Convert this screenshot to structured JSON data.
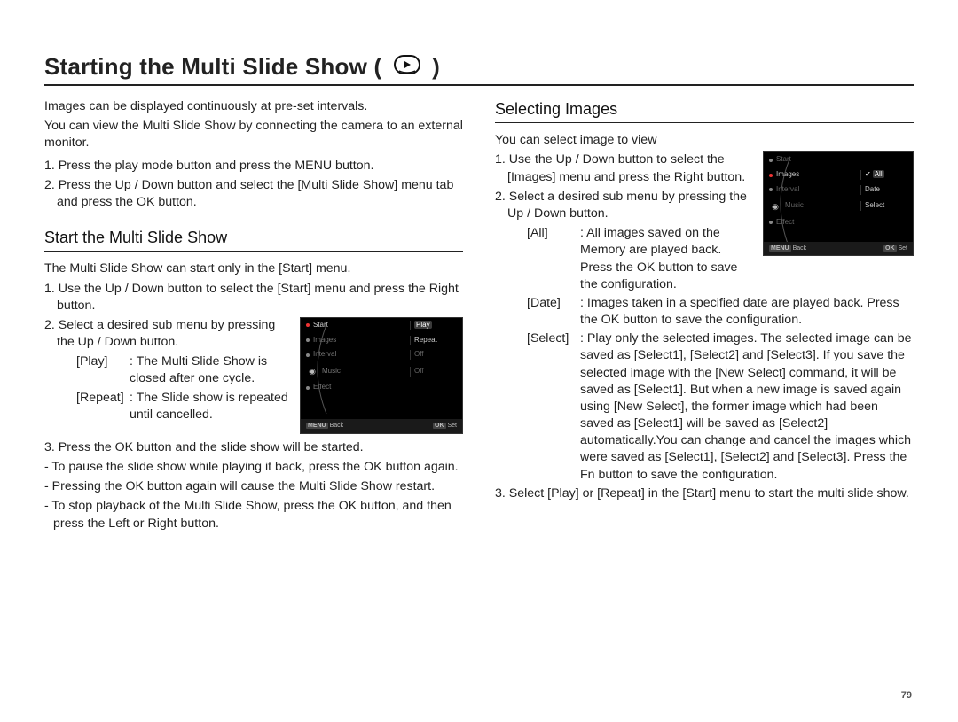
{
  "page_number": "79",
  "title_pre": "Starting the Multi Slide Show ( ",
  "title_post": " )",
  "intro": {
    "p1": "Images can be displayed continuously at pre-set intervals.",
    "p2": "You can view the Multi Slide Show by connecting the camera to an external monitor.",
    "s1": "1. Press the play mode button and press the MENU button.",
    "s2": "2. Press the Up / Down button and select the [Multi Slide Show] menu tab and press the OK button."
  },
  "left": {
    "heading": "Start the Multi Slide Show",
    "p1": "The Multi Slide Show can start only in the [Start] menu.",
    "s1": "1. Use the Up / Down button  to select the [Start] menu and press the Right button.",
    "s2": "2. Select a desired sub menu by pressing the Up / Down button.",
    "play_k": "[Play]",
    "play_v": ": The Multi Slide Show is closed after one cycle.",
    "repeat_k": "[Repeat]",
    "repeat_v": ": The Slide show is repeated until cancelled.",
    "s3": "3. Press the OK button and the slide show will be started.",
    "s3a": "- To pause the slide show while playing it back, press the OK button again.",
    "s3b": "- Pressing the OK button again will cause the Multi Slide Show restart.",
    "s3c": "- To stop playback of the Multi Slide Show, press the OK button, and then press the Left or Right button."
  },
  "right": {
    "heading": "Selecting Images",
    "p1": "You can select image to view",
    "s1": "1. Use the Up / Down button to select the [Images] menu and press the Right button.",
    "s2": "2. Select a desired sub menu by pressing the Up / Down button.",
    "all_k": "[All]",
    "all_v": ": All images saved on the Memory are played back. Press the OK button to save the configuration.",
    "date_k": "[Date]",
    "date_v": ": Images taken in a specified date are played back. Press the OK button to save the configuration.",
    "select_k": "[Select]",
    "select_v": ": Play only the selected images. The selected image can be saved as [Select1], [Select2] and [Select3]. If you save the selected image with the [New Select] command, it will be saved as [Select1]. But when a new image is saved again using [New Select], the former image which had been saved as [Select1] will be saved as [Select2] automatically.You can change and cancel the images which were saved as [Select1], [Select2] and [Select3]. Press the Fn button to save the configuration.",
    "s3": "3. Select [Play] or [Repeat] in the [Start] menu to start the multi slide show."
  },
  "lcd_left": {
    "m1": "Start",
    "m2": "Images",
    "m3": "Interval",
    "m4": "Music",
    "m5": "Effect",
    "r1": "Play",
    "r2": "Repeat",
    "r3": "Off",
    "r4": "Off",
    "back_l": "MENU",
    "back_t": "Back",
    "set_l": "OK",
    "set_t": "Set"
  },
  "lcd_right": {
    "m1": "Start",
    "m2": "Images",
    "m3": "Interval",
    "m4": "Music",
    "m5": "Effect",
    "r1": "All",
    "r2": "Date",
    "r3": "Select",
    "back_l": "MENU",
    "back_t": "Back",
    "set_l": "OK",
    "set_t": "Set"
  }
}
